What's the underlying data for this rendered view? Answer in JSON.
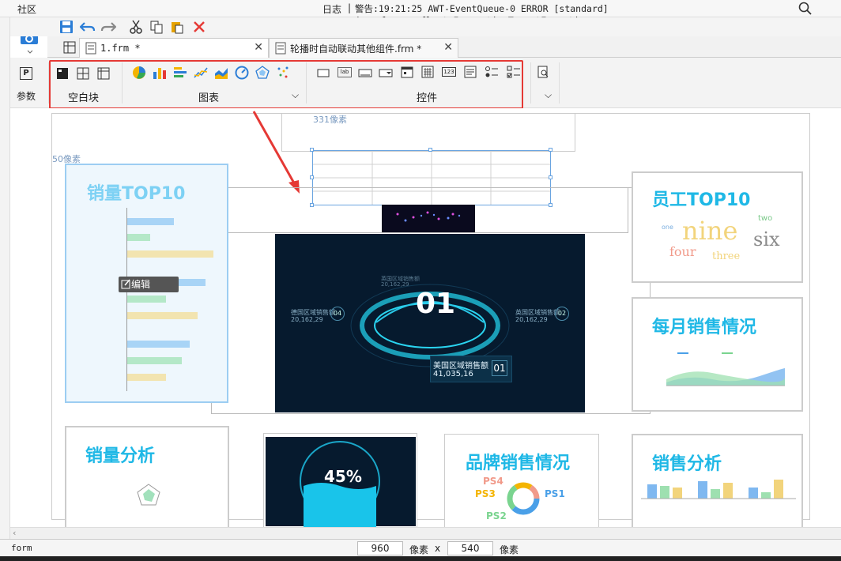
{
  "topbar": {
    "community": "社区",
    "log": "日志",
    "sep": "|",
    "warning": "警告:19:21:25 AWT-EventQueue-0 ERROR [standard] java.lang.reflect.InvocationTargetException"
  },
  "tabs": [
    {
      "label": "1.frm *"
    },
    {
      "label": "轮播时自动联动其他组件.frm *"
    }
  ],
  "ribbon": {
    "param_label": "参数",
    "blank_label": "空白块",
    "chart_label": "图表",
    "widget_label": "控件",
    "lab": "lab",
    "num": "123"
  },
  "guides": {
    "top": "331像素",
    "left": "50像素"
  },
  "panels": {
    "sales_top10": {
      "title": "销量TOP10",
      "edit": "编辑"
    },
    "staff_top10": {
      "title": "员工TOP10",
      "words": [
        "one",
        "nine",
        "two",
        "six",
        "four",
        "three"
      ]
    },
    "monthly": {
      "title": "每月销售情况"
    },
    "sales_analysis": {
      "title": "销量分析"
    },
    "dashboard": {
      "center": "01",
      "labels": [
        "德国区域销售额",
        "20,162,29",
        "英国区域销售额",
        "20,162,29",
        "美国区域销售额",
        "41,035,16"
      ],
      "badges": [
        "04",
        "02",
        "01"
      ]
    },
    "gauge": {
      "value": "45%"
    },
    "brand": {
      "title": "品牌销售情况",
      "legend": [
        "PS4",
        "PS3",
        "PS2",
        "PS1"
      ]
    },
    "sales_analysis2": {
      "title": "销售分析"
    }
  },
  "status": {
    "mode": "form",
    "width": "960",
    "unit1": "像素",
    "x": "x",
    "height": "540",
    "unit2": "像素"
  },
  "colors": {
    "accent": "#1fb8e6",
    "red": "#e53935"
  }
}
